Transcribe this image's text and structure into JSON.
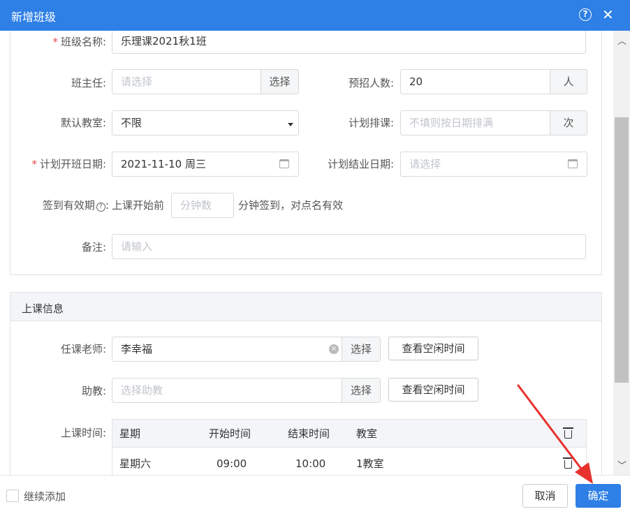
{
  "dialog": {
    "title": "新增班级",
    "help_icon": "?",
    "close_icon": "✕"
  },
  "form": {
    "class_name": {
      "label": "班级名称:",
      "value": "乐理课2021秋1班",
      "required": "*"
    },
    "head_teacher": {
      "label": "班主任:",
      "placeholder": "请选择",
      "button": "选择"
    },
    "planned_count": {
      "label": "预招人数:",
      "value": "20",
      "unit": "人"
    },
    "default_room": {
      "label": "默认教室:",
      "value": "不限"
    },
    "planned_sessions": {
      "label": "计划排课:",
      "placeholder": "不填则按日期排满",
      "unit": "次"
    },
    "start_date": {
      "label": "计划开班日期:",
      "value": "2021-11-10 周三",
      "required": "*"
    },
    "end_date": {
      "label": "计划结业日期:",
      "placeholder": "请选择"
    },
    "checkin": {
      "label": "签到有效期",
      "help": "?",
      "colon": ":",
      "prefix": "上课开始前",
      "placeholder": "分钟数",
      "suffix": "分钟签到，对点名有效"
    },
    "remark": {
      "label": "备注:",
      "placeholder": "请输入"
    }
  },
  "class_info": {
    "section_title": "上课信息",
    "teacher": {
      "label": "任课老师:",
      "value": "李幸福",
      "button": "选择",
      "free_time": "查看空闲时间"
    },
    "assistant": {
      "label": "助教:",
      "placeholder": "选择助教",
      "button": "选择",
      "free_time": "查看空闲时间"
    },
    "schedule": {
      "label": "上课时间:",
      "columns": [
        "星期",
        "开始时间",
        "结束时间",
        "教室"
      ],
      "rows": [
        {
          "day": "星期六",
          "start": "09:00",
          "end": "10:00",
          "room": "1教室"
        }
      ]
    }
  },
  "footer": {
    "continue_add": "继续添加",
    "cancel": "取消",
    "confirm": "确定"
  },
  "colors": {
    "primary": "#2e7fe6",
    "required": "#e64b4b",
    "annotation_arrow": "#e8322e"
  }
}
